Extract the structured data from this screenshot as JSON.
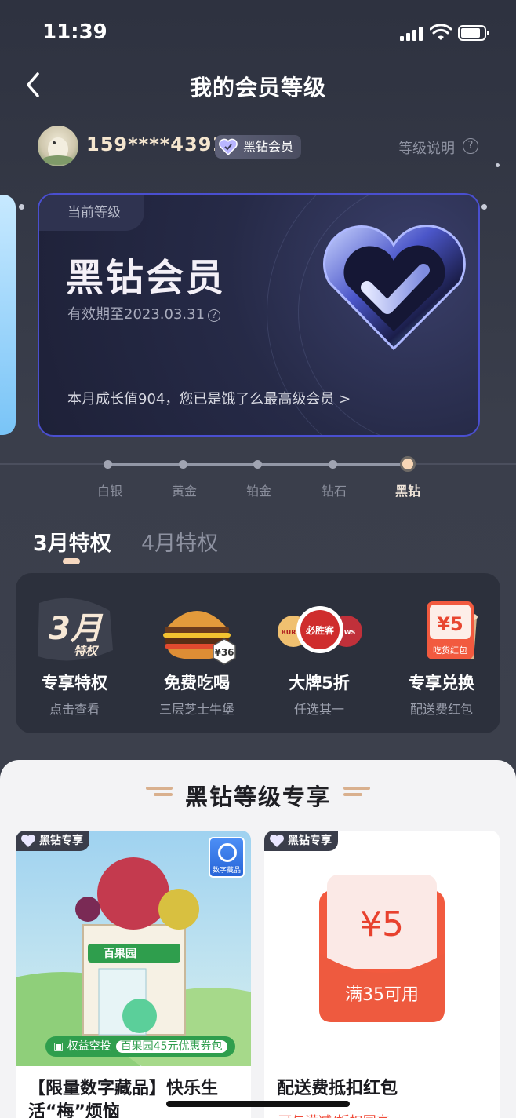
{
  "status_bar": {
    "time": "11:39"
  },
  "nav": {
    "title": "我的会员等级"
  },
  "user": {
    "phone": "159****4391",
    "badge": "黑钻会员",
    "level_info": "等级说明",
    "help": "?"
  },
  "card": {
    "current_tag": "当前等级",
    "level_name": "黑钻会员",
    "expiry": "有效期至2023.03.31",
    "expiry_help": "?",
    "growth": "本月成长值904，您已是饿了么最高级会员 >"
  },
  "levels": [
    "白银",
    "黄金",
    "铂金",
    "钻石",
    "黑钻"
  ],
  "tabs": {
    "current": "3月特权",
    "next": "4月特权"
  },
  "perks": [
    {
      "icon": "march-privilege-icon",
      "title": "专享特权",
      "sub": "点击查看",
      "icon_text_big": "3月",
      "icon_text_small": "特权"
    },
    {
      "icon": "burger-icon",
      "title": "免费吃喝",
      "sub": "三层芝士牛堡",
      "price": "¥36"
    },
    {
      "icon": "brand-logos-icon",
      "title": "大牌5折",
      "sub": "任选其一",
      "logo_text": "必胜客",
      "left_logo": "BUR KI",
      "right_logo": "WS"
    },
    {
      "icon": "coupon-coffee-icon",
      "title": "专享兑换",
      "sub": "配送费红包",
      "coupon_value": "¥5",
      "coupon_label": "吃货红包"
    }
  ],
  "section": {
    "title": "黑钻等级专享"
  },
  "products": [
    {
      "tag": "黑钻专享",
      "digital_badge": "数字藏品",
      "shop_sign": "百果园",
      "airdrop_label": "权益空投",
      "airdrop_text": "百果园45元优惠券包",
      "title": "【限量数字藏品】快乐生活“梅”烦恼"
    },
    {
      "tag": "黑钻专享",
      "packet_value": "¥5",
      "packet_condition": "满35可用",
      "title": "配送费抵扣红包",
      "sub": "可与满减/折扣同享"
    }
  ],
  "colors": {
    "accent": "#f6d8c0",
    "card_border": "#4a4fd0",
    "coupon_red": "#f04b3a"
  }
}
